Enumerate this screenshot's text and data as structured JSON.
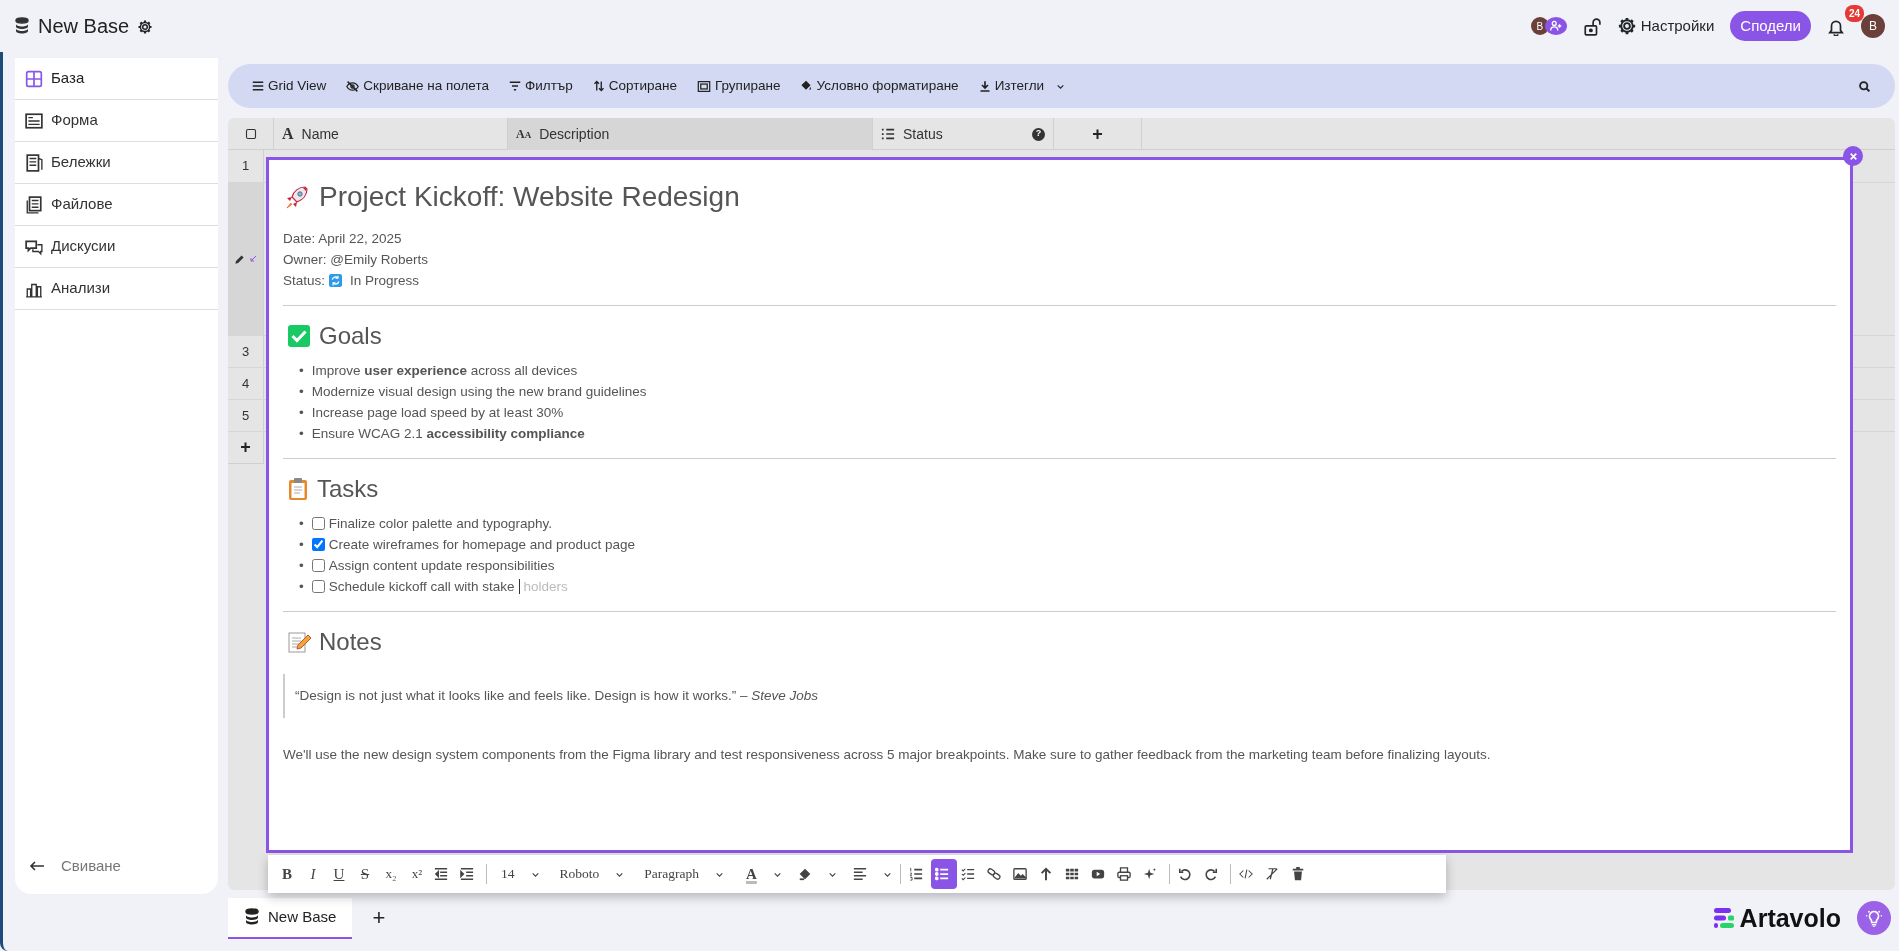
{
  "top_bar": {
    "title": "New Base",
    "avatars": [
      {
        "initial": "B"
      }
    ],
    "settings_label": "Настройки",
    "share_label": "Сподели",
    "notifications": "24",
    "user_initial": "B"
  },
  "sidebar": {
    "items": [
      {
        "label": "База",
        "selected": true
      },
      {
        "label": "Форма",
        "selected": false
      },
      {
        "label": "Бележки",
        "selected": false
      },
      {
        "label": "Файлове",
        "selected": false
      },
      {
        "label": "Дискусии",
        "selected": false
      },
      {
        "label": "Анализи",
        "selected": false
      }
    ],
    "collapse_label": "Свиване"
  },
  "grid_toolbar": {
    "buttons": [
      {
        "label": "Grid View",
        "dropdown": false
      },
      {
        "label": "Скриване на полета",
        "dropdown": false
      },
      {
        "label": "Филтър",
        "dropdown": false
      },
      {
        "label": "Сортиране",
        "dropdown": false
      },
      {
        "label": "Групиране",
        "dropdown": false
      },
      {
        "label": "Условно форматиране",
        "dropdown": false
      },
      {
        "label": "Изтегли",
        "dropdown": true
      }
    ]
  },
  "grid": {
    "columns": [
      {
        "label": "Name",
        "kind": "text",
        "glyph": "A"
      },
      {
        "label": "Description",
        "kind": "long_text",
        "glyph": "AA"
      },
      {
        "label": "Status",
        "kind": "single_select",
        "help": "?"
      }
    ],
    "add_column": "+",
    "rows": [
      {
        "number": "1",
        "selected": false
      },
      {
        "selected": true
      },
      {
        "number": "3",
        "selected": false
      },
      {
        "number": "4",
        "selected": false
      },
      {
        "number": "5",
        "selected": false
      }
    ],
    "add_row": "+"
  },
  "editor": {
    "title": "Project Kickoff: Website Redesign",
    "meta": [
      {
        "text": "Date: April 22, 2025"
      },
      {
        "text": "Owner: @Emily Roberts"
      },
      {
        "label": "Status:",
        "value": "In Progress"
      }
    ],
    "sections": [
      {
        "heading": "Goals",
        "kind": "bullets",
        "marker": "•",
        "items": [
          "Improve **user experience** across all devices",
          "Modernize visual design using the new brand guidelines",
          "Increase page load speed by at least 30%",
          "Ensure WCAG 2.1 **accessibility compliance**"
        ]
      },
      {
        "heading": "Tasks",
        "kind": "tasks",
        "marker": "•",
        "items": [
          {
            "text": "Finalize color palette and typography.",
            "checked": false
          },
          {
            "text": "Create wireframes for homepage and product page",
            "checked": true
          },
          {
            "text": "Assign content update responsibilities",
            "checked": false
          },
          {
            "text": "Schedule kickoff call with stake",
            "suggestion": "holders",
            "checked": false
          }
        ]
      },
      {
        "heading": "Notes",
        "kind": "notes",
        "quote": "“Design is not just what it looks like and feels like. Design is how it works.” – *Steve Jobs*",
        "paragraph": "We'll use the new design system components from the Figma library and test responsiveness across 5 major breakpoints. Make sure to gather feedback from the marketing team before finalizing layouts."
      }
    ]
  },
  "editor_toolbar": {
    "items": [
      {
        "kind": "format",
        "label": "B"
      },
      {
        "kind": "format",
        "label": "I"
      },
      {
        "kind": "format",
        "label": "U"
      },
      {
        "kind": "format",
        "label": "S"
      },
      {
        "kind": "format",
        "label": "x₂"
      },
      {
        "kind": "format",
        "label": "x²"
      },
      {
        "kind": "icon",
        "selected": false
      },
      {
        "kind": "icon",
        "selected": false
      },
      {
        "kind": "separator"
      },
      {
        "kind": "select",
        "label": "14"
      },
      {
        "kind": "select",
        "label": "Roboto"
      },
      {
        "kind": "select",
        "label": "Paragraph"
      },
      {
        "kind": "color",
        "label": "A"
      },
      {
        "kind": "icon",
        "selected": false,
        "dropdown": true
      },
      {
        "kind": "icon",
        "selected": false,
        "dropdown": true
      },
      {
        "kind": "separator"
      },
      {
        "kind": "icon",
        "selected": false
      },
      {
        "kind": "icon",
        "selected": true
      },
      {
        "kind": "icon",
        "selected": false
      },
      {
        "kind": "icon",
        "selected": false
      },
      {
        "kind": "icon",
        "selected": false
      },
      {
        "kind": "icon",
        "selected": false
      },
      {
        "kind": "icon",
        "selected": false
      },
      {
        "kind": "icon",
        "selected": false
      },
      {
        "kind": "icon",
        "selected": false
      },
      {
        "kind": "icon",
        "selected": false
      },
      {
        "kind": "separator"
      },
      {
        "kind": "icon",
        "selected": false
      },
      {
        "kind": "icon",
        "selected": false
      },
      {
        "kind": "separator"
      },
      {
        "kind": "icon",
        "selected": false
      },
      {
        "kind": "icon",
        "selected": false
      },
      {
        "kind": "icon",
        "selected": false
      }
    ]
  },
  "tabs": [
    {
      "label": "New Base",
      "selected": true
    }
  ],
  "add_tab": "+",
  "brand": "Artavolo"
}
